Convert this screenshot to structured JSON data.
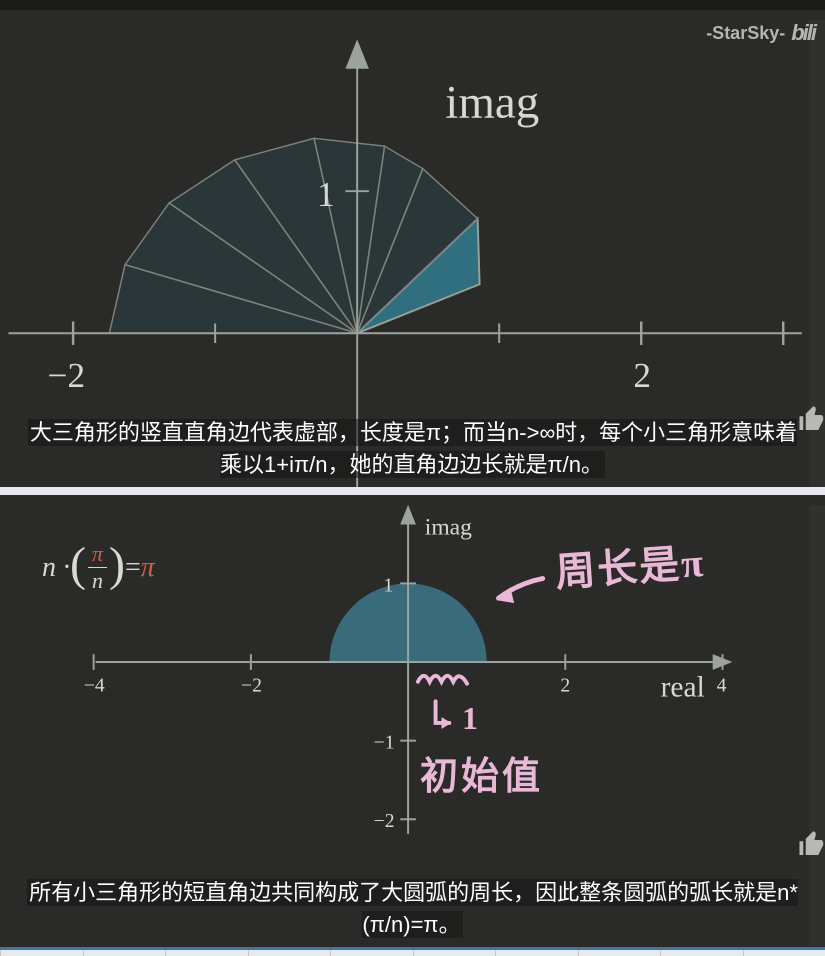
{
  "watermark": {
    "author": "-StarSky-",
    "site": "bili"
  },
  "top": {
    "imag_label": "imag",
    "y_tick_1": "1",
    "x_tick_neg2": "−2",
    "x_tick_pos2": "2",
    "caption": "大三角形的竖直直角边代表虚部，长度是π；而当n->∞时，每个小三角形意味着乘以1+iπ/n，她的直角边边长就是π/n。"
  },
  "bottom": {
    "imag_label": "imag",
    "real_label": "real",
    "x_ticks": {
      "neg4": "−4",
      "neg2": "−2",
      "pos2": "2",
      "pos4": "4"
    },
    "y_ticks": {
      "pos1": "1",
      "neg1": "−1",
      "neg2": "−2"
    },
    "formula": {
      "n_dot": "n ·",
      "pi_top": "π",
      "n_bottom": "n",
      "equals": " = ",
      "pi_result": "π"
    },
    "annotations": {
      "circumference": "周长是π",
      "initial_value": "初始值",
      "arrow_1": "1"
    },
    "caption": "所有小三角形的短直角边共同构成了大圆弧的周长，因此整条圆弧的弧长就是n*(π/n)=π。"
  },
  "chart_data": [
    {
      "type": "diagram",
      "title": "Triangle fan approximating semicircle",
      "axes": {
        "x_range": [
          -2.5,
          3
        ],
        "y_range": [
          -0.8,
          3.2
        ],
        "imag_axis": true
      },
      "fan": {
        "n_wedges": 8,
        "radius_approx": 1.7,
        "highlighted_wedge_index": 6
      },
      "ticks_x": [
        -2,
        2
      ],
      "ticks_y": [
        1
      ]
    },
    {
      "type": "diagram",
      "title": "Semicircle arc length π",
      "axes": {
        "x_range": [
          -4.5,
          4.5
        ],
        "y_range": [
          -2.3,
          2
        ],
        "real_axis": true,
        "imag_axis": true
      },
      "semicircle": {
        "center": [
          0,
          0
        ],
        "radius": 1,
        "fill": "#3a6b7a"
      },
      "formula": "n·(π/n)=π",
      "annotations": [
        "周长是π",
        "初始值",
        "1"
      ],
      "ticks_x": [
        -4,
        -2,
        2,
        4
      ],
      "ticks_y": [
        1,
        -1,
        -2
      ]
    }
  ]
}
